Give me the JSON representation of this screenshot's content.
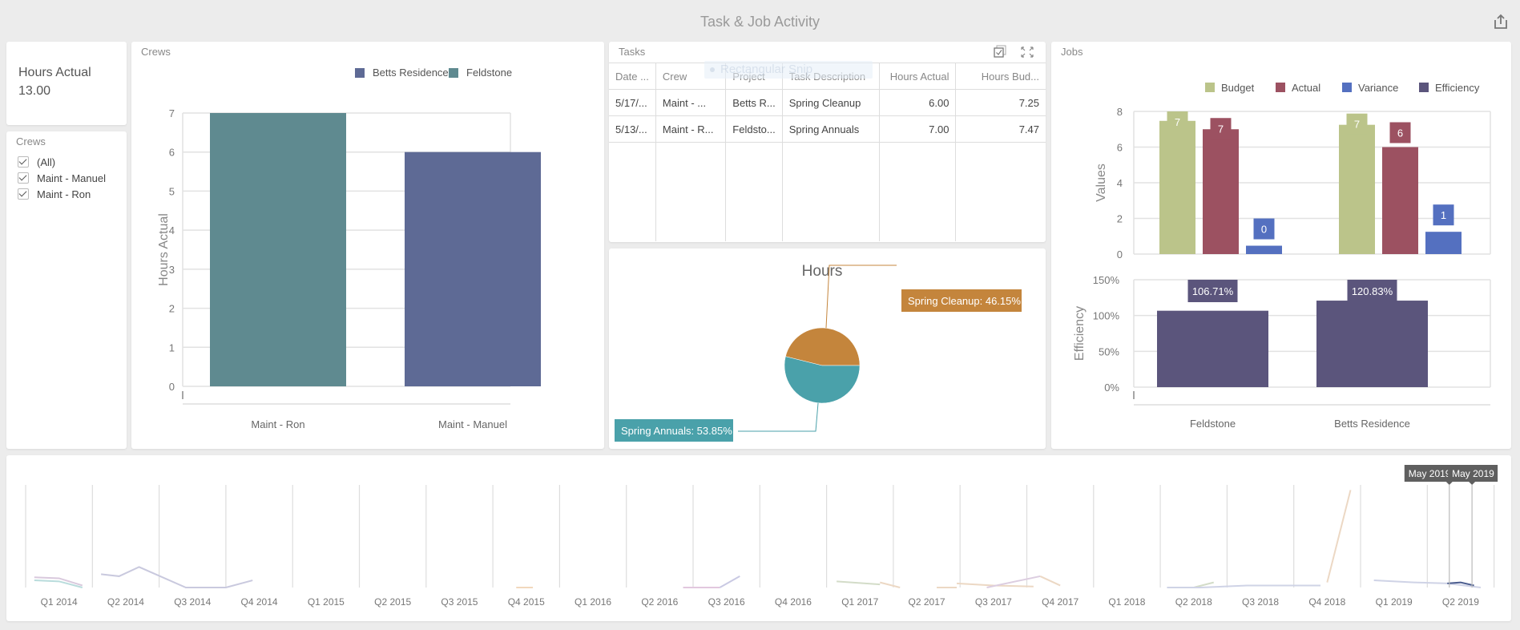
{
  "header": {
    "title": "Task & Job Activity",
    "export_icon": "export-icon"
  },
  "hours_card": {
    "label": "Hours Actual",
    "value": "13.00"
  },
  "crew_filter": {
    "title": "Crews",
    "items": [
      {
        "label": "(All)",
        "checked": true
      },
      {
        "label": "Maint - Manuel",
        "checked": true
      },
      {
        "label": "Maint - Ron",
        "checked": true
      }
    ]
  },
  "tasks": {
    "title": "Tasks",
    "icons": [
      "multi-select-icon",
      "maximize-icon"
    ],
    "overlay_text": "Rectangular Snip",
    "columns": [
      "Date ...",
      "Crew",
      "Project",
      "Task Description",
      "Hours Actual",
      "Hours Bud..."
    ],
    "rows": [
      [
        "5/17/...",
        "Maint - ...",
        "Betts R...",
        "Spring Cleanup",
        "6.00",
        "7.25"
      ],
      [
        "5/13/...",
        "Maint - R...",
        "Feldsto...",
        "Spring Annuals",
        "7.00",
        "7.47"
      ]
    ]
  },
  "colors": {
    "betts": "#5e6a95",
    "feldstone": "#5f8a90",
    "budget": "#bbc48a",
    "actual": "#9c5161",
    "variance": "#5470c0",
    "efficiency": "#5b557c",
    "spring_cleanup": "#c4853c",
    "spring_annuals": "#4aa1aa"
  },
  "chart_data": [
    {
      "id": "crews",
      "type": "bar",
      "panel_title": "Crews",
      "categories": [
        "Maint - Ron",
        "Maint - Manuel"
      ],
      "series": [
        {
          "name": "Betts Residence",
          "values": [
            0,
            6
          ]
        },
        {
          "name": "Feldstone",
          "values": [
            7,
            0
          ]
        }
      ],
      "bar_series": [
        "Feldstone",
        "Betts Residence"
      ],
      "legend": [
        "Betts Residence",
        "Feldstone"
      ],
      "legend_position": "top-right",
      "ylabel": "Hours Actual",
      "ylim": [
        0,
        7
      ],
      "yticks": [
        "0",
        "1",
        "2",
        "3",
        "4",
        "5",
        "6",
        "7"
      ],
      "grid": true
    },
    {
      "id": "hours",
      "type": "pie",
      "title": "Hours",
      "slices": [
        {
          "label": "Spring Cleanup",
          "value": 46.15,
          "text": "Spring Cleanup: 46.15%"
        },
        {
          "label": "Spring Annuals",
          "value": 53.85,
          "text": "Spring Annuals: 53.85%"
        }
      ]
    },
    {
      "id": "jobs-values",
      "type": "bar",
      "panel_title": "Jobs",
      "categories": [
        "Feldstone",
        "Betts Residence"
      ],
      "series": [
        {
          "name": "Budget",
          "values": [
            7.47,
            7.25
          ],
          "labels": [
            "7",
            "7"
          ]
        },
        {
          "name": "Actual",
          "values": [
            7,
            6
          ],
          "labels": [
            "7",
            "6"
          ]
        },
        {
          "name": "Variance",
          "values": [
            0.47,
            1.25
          ],
          "labels": [
            "0",
            "1"
          ]
        }
      ],
      "legend": [
        "Budget",
        "Actual",
        "Variance",
        "Efficiency"
      ],
      "legend_position": "top-right",
      "ylabel": "Values",
      "ylim": [
        0,
        8
      ],
      "yticks": [
        "0",
        "2",
        "4",
        "6",
        "8"
      ],
      "grid": true
    },
    {
      "id": "jobs-efficiency",
      "type": "bar",
      "categories": [
        "Feldstone",
        "Betts Residence"
      ],
      "series": [
        {
          "name": "Efficiency",
          "values": [
            106.71,
            120.83
          ],
          "labels": [
            "106.71%",
            "120.83%"
          ]
        }
      ],
      "ylabel": "Efficiency",
      "ylim": [
        0,
        150
      ],
      "yticks": [
        "0%",
        "50%",
        "100%",
        "150%"
      ],
      "grid": true
    },
    {
      "id": "timeline",
      "type": "line",
      "x_ticks": [
        "Q1 2014",
        "Q2 2014",
        "Q3 2014",
        "Q4 2014",
        "Q1 2015",
        "Q2 2015",
        "Q3 2015",
        "Q4 2015",
        "Q1 2016",
        "Q2 2016",
        "Q3 2016",
        "Q4 2016",
        "Q1 2017",
        "Q2 2017",
        "Q3 2017",
        "Q4 2017",
        "Q1 2018",
        "Q2 2018",
        "Q3 2018",
        "Q4 2018",
        "Q1 2019",
        "Q2 2019"
      ],
      "selection": {
        "start": "May 2019",
        "end": "May 2019",
        "start_q": 21.33,
        "end_q": 21.67
      },
      "series": [
        {
          "name": "s1",
          "color": "#d9c9dd",
          "points": [
            [
              0.13,
              0.1
            ],
            [
              0.5,
              0.09
            ],
            [
              0.85,
              0.02
            ]
          ]
        },
        {
          "name": "s2",
          "color": "#b9dcdc",
          "points": [
            [
              0.13,
              0.07
            ],
            [
              0.5,
              0.06
            ],
            [
              0.85,
              0.0
            ]
          ]
        },
        {
          "name": "s3",
          "color": "#c9c9de",
          "points": [
            [
              1.13,
              0.13
            ],
            [
              1.4,
              0.11
            ],
            [
              1.7,
              0.2
            ],
            [
              2.4,
              0.0
            ],
            [
              3.0,
              0.0
            ],
            [
              3.4,
              0.07
            ]
          ]
        },
        {
          "name": "s4",
          "color": "#f1d8bd",
          "points": [
            [
              7.35,
              0.0
            ],
            [
              7.6,
              0.0
            ]
          ]
        },
        {
          "name": "s5",
          "color": "#e2c8de",
          "points": [
            [
              9.85,
              0.0
            ],
            [
              10.4,
              0.0
            ]
          ]
        },
        {
          "name": "s6",
          "color": "#c9c9e3",
          "points": [
            [
              10.4,
              0.0
            ],
            [
              10.7,
              0.11
            ]
          ]
        },
        {
          "name": "s7",
          "color": "#d3dcc8",
          "points": [
            [
              12.15,
              0.06
            ],
            [
              12.8,
              0.03
            ]
          ]
        },
        {
          "name": "s8",
          "color": "#ecd8c4",
          "points": [
            [
              12.8,
              0.05
            ],
            [
              13.1,
              0.0
            ]
          ]
        },
        {
          "name": "s9",
          "color": "#ecd8c4",
          "points": [
            [
              13.65,
              0.0
            ],
            [
              13.95,
              0.0
            ]
          ]
        },
        {
          "name": "s10",
          "color": "#ecd8c4",
          "points": [
            [
              13.95,
              0.04
            ],
            [
              14.5,
              0.02
            ],
            [
              15.1,
              0.01
            ]
          ]
        },
        {
          "name": "s11",
          "color": "#dccde0",
          "points": [
            [
              14.4,
              0.0
            ],
            [
              15.2,
              0.11
            ]
          ]
        },
        {
          "name": "s12",
          "color": "#ecd8c4",
          "points": [
            [
              15.2,
              0.11
            ],
            [
              15.5,
              0.02
            ]
          ]
        },
        {
          "name": "s13",
          "color": "#d3dcc8",
          "points": [
            [
              17.5,
              0.0
            ],
            [
              17.8,
              0.05
            ]
          ]
        },
        {
          "name": "s14",
          "color": "#cfd3e6",
          "points": [
            [
              17.1,
              0.0
            ],
            [
              17.6,
              0.0
            ],
            [
              18.3,
              0.02
            ],
            [
              19.4,
              0.02
            ]
          ]
        },
        {
          "name": "s15",
          "color": "#ecd8c4",
          "points": [
            [
              19.5,
              0.05
            ],
            [
              19.85,
              0.95
            ]
          ]
        },
        {
          "name": "s16",
          "color": "#cfd3e6",
          "points": [
            [
              20.2,
              0.07
            ],
            [
              20.8,
              0.05
            ],
            [
              21.3,
              0.04
            ],
            [
              21.8,
              0.0
            ]
          ]
        },
        {
          "name": "s17",
          "color": "#4b5d8f",
          "points": [
            [
              21.3,
              0.04
            ],
            [
              21.5,
              0.05
            ],
            [
              21.7,
              0.02
            ]
          ]
        }
      ]
    }
  ]
}
